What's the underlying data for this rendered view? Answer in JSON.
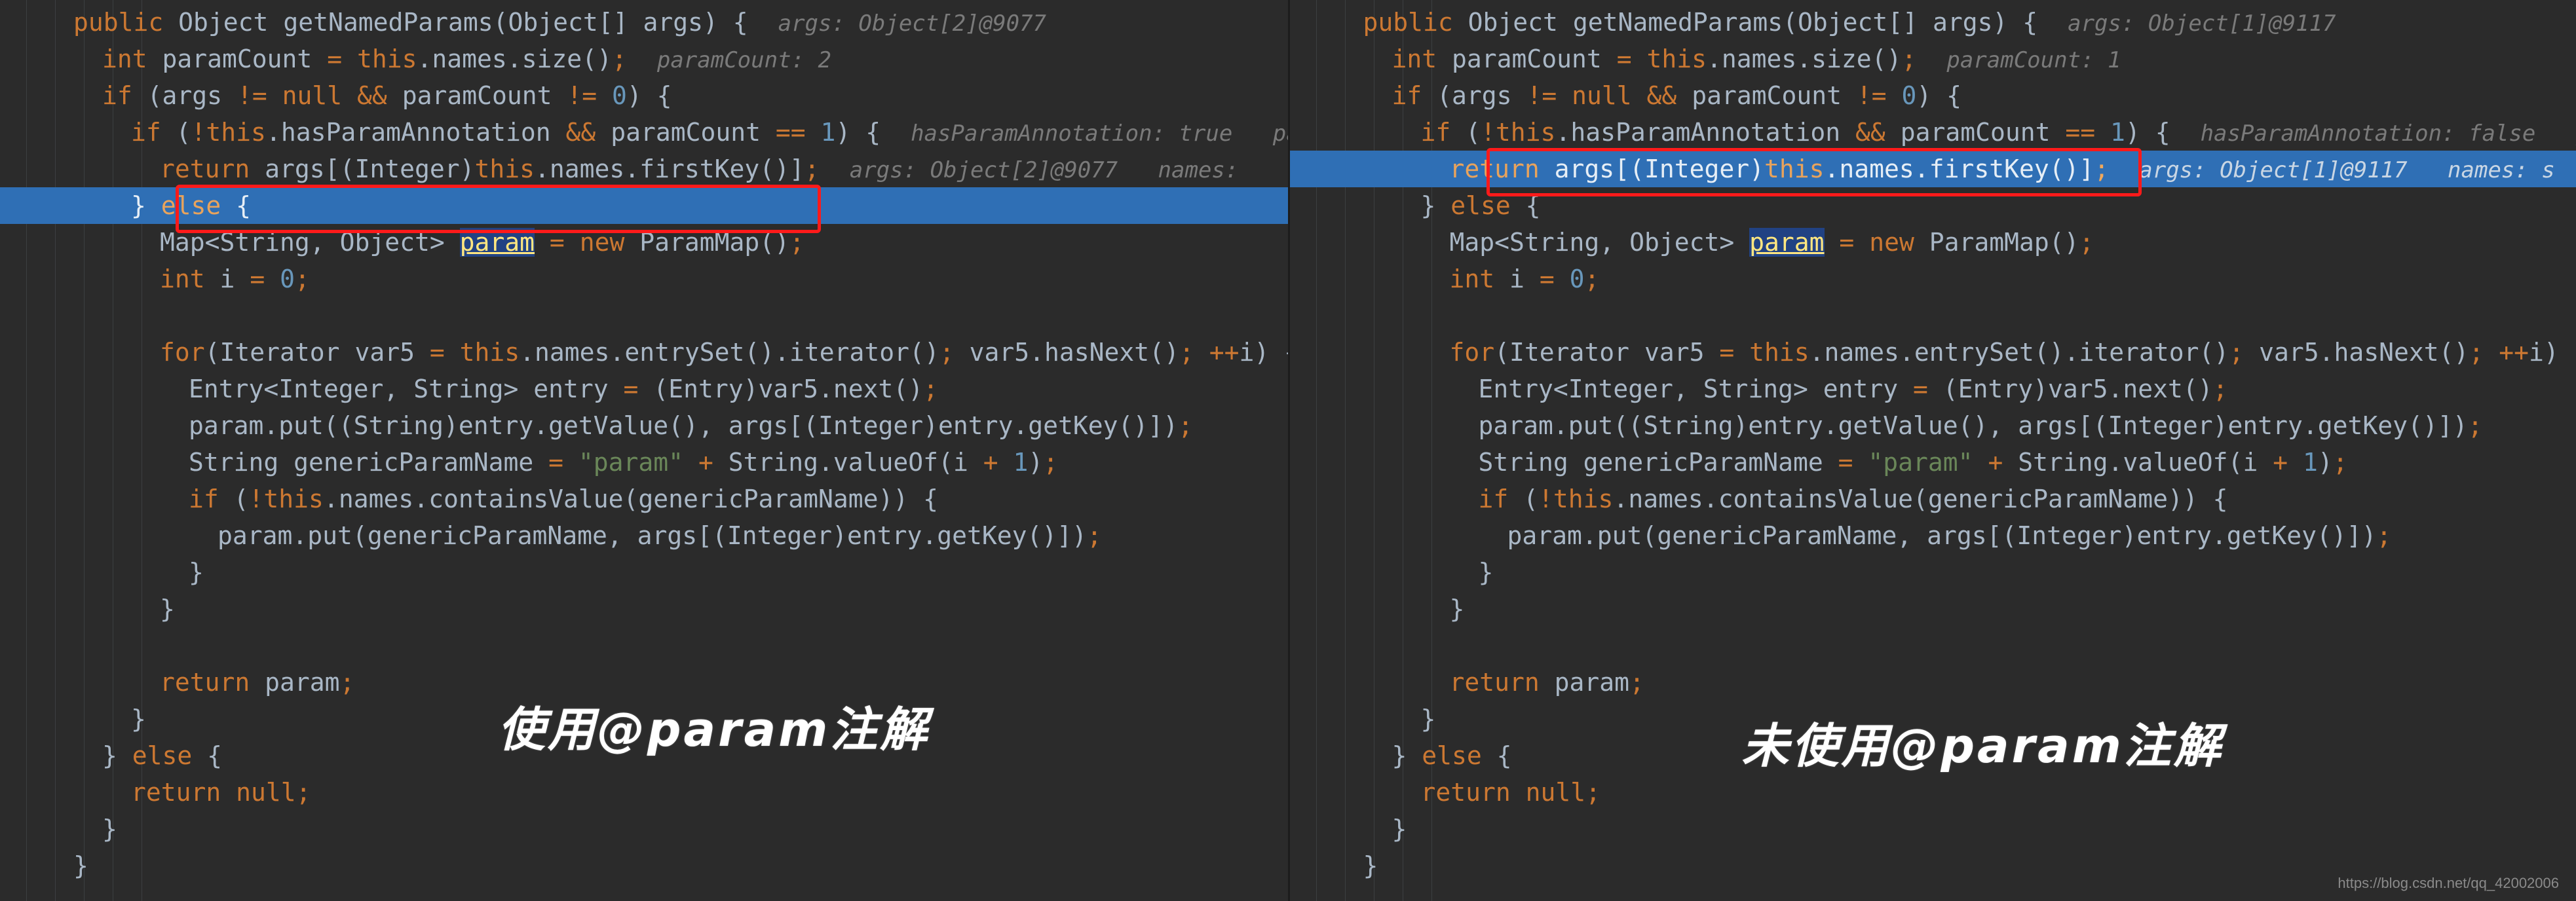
{
  "meta": {
    "theme": "darcula",
    "background": "#2b2b2b",
    "foreground": "#a9b7c6",
    "exec_line_color": "#2f6fb5",
    "annotation_box_color": "#ff1a1a",
    "keyword_color": "#cc7832",
    "string_color": "#6a8759",
    "number_color": "#6897bb",
    "hint_color": "#7a7a7a"
  },
  "watermark": "https://blog.csdn.net/qq_42002006",
  "left_panel": {
    "caption": "使用@param注解",
    "executing_line_index": 5,
    "annotated_line_index": 5,
    "lines": [
      {
        "indent": 0,
        "code": "public Object getNamedParams(Object[] args) {",
        "hint": "args: Object[2]@9077"
      },
      {
        "indent": 1,
        "code": "int paramCount = this.names.size();",
        "hint": "paramCount: 2"
      },
      {
        "indent": 1,
        "code": "if (args != null && paramCount != 0) {",
        "hint": ""
      },
      {
        "indent": 2,
        "code": "if (!this.hasParamAnnotation && paramCount == 1) {",
        "hint": "hasParamAnnotation: true   pa"
      },
      {
        "indent": 3,
        "code": "return args[(Integer)this.names.firstKey()];",
        "hint": "args: Object[2]@9077   names:"
      },
      {
        "indent": 2,
        "code": "} else {",
        "hint": ""
      },
      {
        "indent": 3,
        "code": "Map<String, Object> param = new ParamMap();",
        "hint": ""
      },
      {
        "indent": 3,
        "code": "int i = 0;",
        "hint": ""
      },
      {
        "indent": 0,
        "code": "",
        "hint": ""
      },
      {
        "indent": 3,
        "code": "for(Iterator var5 = this.names.entrySet().iterator(); var5.hasNext(); ++i) {",
        "hint": ""
      },
      {
        "indent": 4,
        "code": "Entry<Integer, String> entry = (Entry)var5.next();",
        "hint": ""
      },
      {
        "indent": 4,
        "code": "param.put((String)entry.getValue(), args[(Integer)entry.getKey()]);",
        "hint": ""
      },
      {
        "indent": 4,
        "code": "String genericParamName = \"param\" + String.valueOf(i + 1);",
        "hint": ""
      },
      {
        "indent": 4,
        "code": "if (!this.names.containsValue(genericParamName)) {",
        "hint": ""
      },
      {
        "indent": 5,
        "code": "param.put(genericParamName, args[(Integer)entry.getKey()]);",
        "hint": ""
      },
      {
        "indent": 4,
        "code": "}",
        "hint": ""
      },
      {
        "indent": 3,
        "code": "}",
        "hint": ""
      },
      {
        "indent": 0,
        "code": "",
        "hint": ""
      },
      {
        "indent": 3,
        "code": "return param;",
        "hint": ""
      },
      {
        "indent": 2,
        "code": "}",
        "hint": ""
      },
      {
        "indent": 1,
        "code": "} else {",
        "hint": ""
      },
      {
        "indent": 2,
        "code": "return null;",
        "hint": ""
      },
      {
        "indent": 1,
        "code": "}",
        "hint": ""
      },
      {
        "indent": 0,
        "code": "}",
        "hint": ""
      }
    ]
  },
  "right_panel": {
    "caption": "未使用@param注解",
    "executing_line_index": 4,
    "annotated_line_index": 4,
    "lines": [
      {
        "indent": 0,
        "code": "public Object getNamedParams(Object[] args) {",
        "hint": "args: Object[1]@9117"
      },
      {
        "indent": 1,
        "code": "int paramCount = this.names.size();",
        "hint": "paramCount: 1"
      },
      {
        "indent": 1,
        "code": "if (args != null && paramCount != 0) {",
        "hint": ""
      },
      {
        "indent": 2,
        "code": "if (!this.hasParamAnnotation && paramCount == 1) {",
        "hint": "hasParamAnnotation: false   pa"
      },
      {
        "indent": 3,
        "code": "return args[(Integer)this.names.firstKey()];",
        "hint": "args: Object[1]@9117   names: s"
      },
      {
        "indent": 2,
        "code": "} else {",
        "hint": ""
      },
      {
        "indent": 3,
        "code": "Map<String, Object> param = new ParamMap();",
        "hint": ""
      },
      {
        "indent": 3,
        "code": "int i = 0;",
        "hint": ""
      },
      {
        "indent": 0,
        "code": "",
        "hint": ""
      },
      {
        "indent": 3,
        "code": "for(Iterator var5 = this.names.entrySet().iterator(); var5.hasNext(); ++i) {",
        "hint": ""
      },
      {
        "indent": 4,
        "code": "Entry<Integer, String> entry = (Entry)var5.next();",
        "hint": ""
      },
      {
        "indent": 4,
        "code": "param.put((String)entry.getValue(), args[(Integer)entry.getKey()]);",
        "hint": ""
      },
      {
        "indent": 4,
        "code": "String genericParamName = \"param\" + String.valueOf(i + 1);",
        "hint": ""
      },
      {
        "indent": 4,
        "code": "if (!this.names.containsValue(genericParamName)) {",
        "hint": ""
      },
      {
        "indent": 5,
        "code": "param.put(genericParamName, args[(Integer)entry.getKey()]);",
        "hint": ""
      },
      {
        "indent": 4,
        "code": "}",
        "hint": ""
      },
      {
        "indent": 3,
        "code": "}",
        "hint": ""
      },
      {
        "indent": 0,
        "code": "",
        "hint": ""
      },
      {
        "indent": 3,
        "code": "return param;",
        "hint": ""
      },
      {
        "indent": 2,
        "code": "}",
        "hint": ""
      },
      {
        "indent": 1,
        "code": "} else {",
        "hint": ""
      },
      {
        "indent": 2,
        "code": "return null;",
        "hint": ""
      },
      {
        "indent": 1,
        "code": "}",
        "hint": ""
      },
      {
        "indent": 0,
        "code": "}",
        "hint": ""
      }
    ]
  }
}
